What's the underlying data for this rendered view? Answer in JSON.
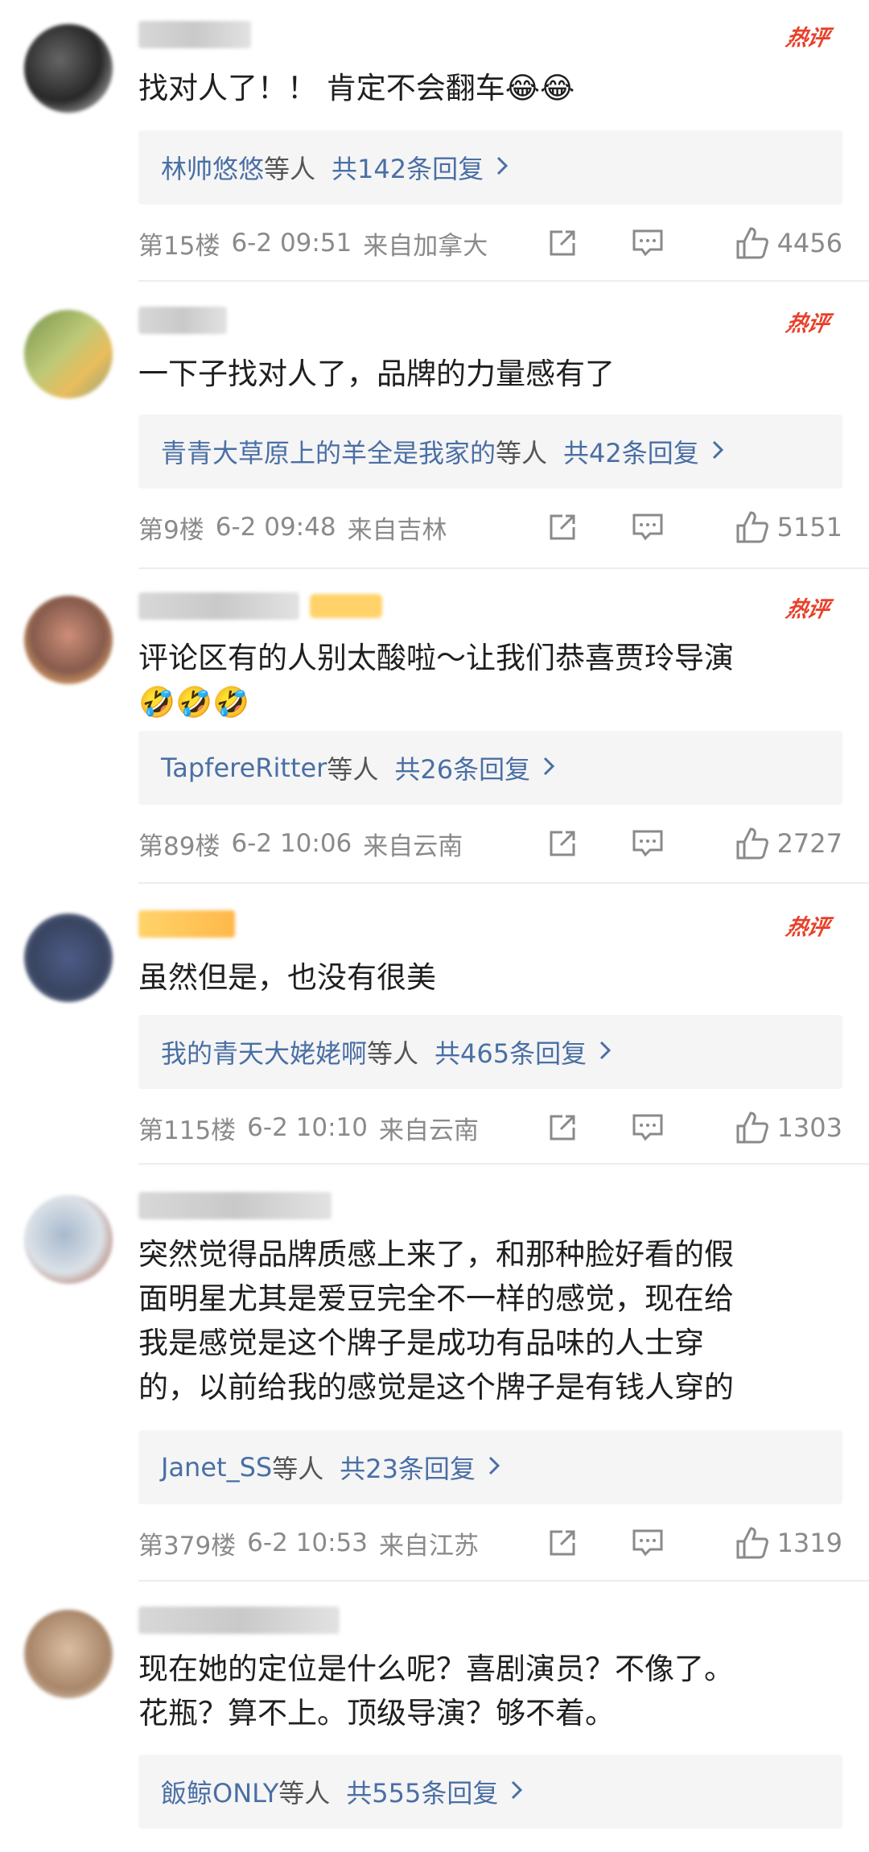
{
  "hot_label": "热评",
  "icons": {
    "share": "share-icon",
    "reply": "comment-icon",
    "like": "thumbs-up-icon",
    "arrow": "chevron-right-icon"
  },
  "comments": [
    {
      "text": "找对人了！！ 肯定不会翻车😂😂",
      "reply_who": "林帅悠悠",
      "reply_tail": "等人",
      "reply_count": "共142条回复",
      "floor": "第15楼",
      "date": "6-2 09:51",
      "location": "来自加拿大",
      "likes": "4456"
    },
    {
      "text": "一下子找对人了，品牌的力量感有了",
      "reply_who": "青青大草原上的羊全是我家的",
      "reply_tail": "等人",
      "reply_count": "共42条回复",
      "floor": "第9楼",
      "date": "6-2 09:48",
      "location": "来自吉林",
      "likes": "5151"
    },
    {
      "text": "评论区有的人别太酸啦～让我们恭喜贾玲导演\n🤣🤣🤣",
      "reply_who": "TapfereRitter",
      "reply_tail": "等人",
      "reply_count": "共26条回复",
      "floor": "第89楼",
      "date": "6-2 10:06",
      "location": "来自云南",
      "likes": "2727"
    },
    {
      "text": "虽然但是，也没有很美",
      "reply_who": "我的青天大姥姥啊",
      "reply_tail": "等人",
      "reply_count": "共465条回复",
      "floor": "第115楼",
      "date": "6-2 10:10",
      "location": "来自云南",
      "likes": "1303"
    },
    {
      "text": "突然觉得品牌质感上来了，和那种脸好看的假\n面明星尤其是爱豆完全不一样的感觉，现在给\n我是感觉是这个牌子是成功有品味的人士穿\n的，以前给我的感觉是这个牌子是有钱人穿的",
      "reply_who": "Janet_SS",
      "reply_tail": "等人",
      "reply_count": "共23条回复",
      "floor": "第379楼",
      "date": "6-2 10:53",
      "location": "来自江苏",
      "likes": "1319"
    },
    {
      "text": "现在她的定位是什么呢？喜剧演员？不像了。\n花瓶？算不上。顶级导演？够不着。",
      "reply_who": "飯鲸ONLY",
      "reply_tail": "等人",
      "reply_count": "共555条回复",
      "floor": "",
      "date": "",
      "location": "",
      "likes": ""
    }
  ]
}
